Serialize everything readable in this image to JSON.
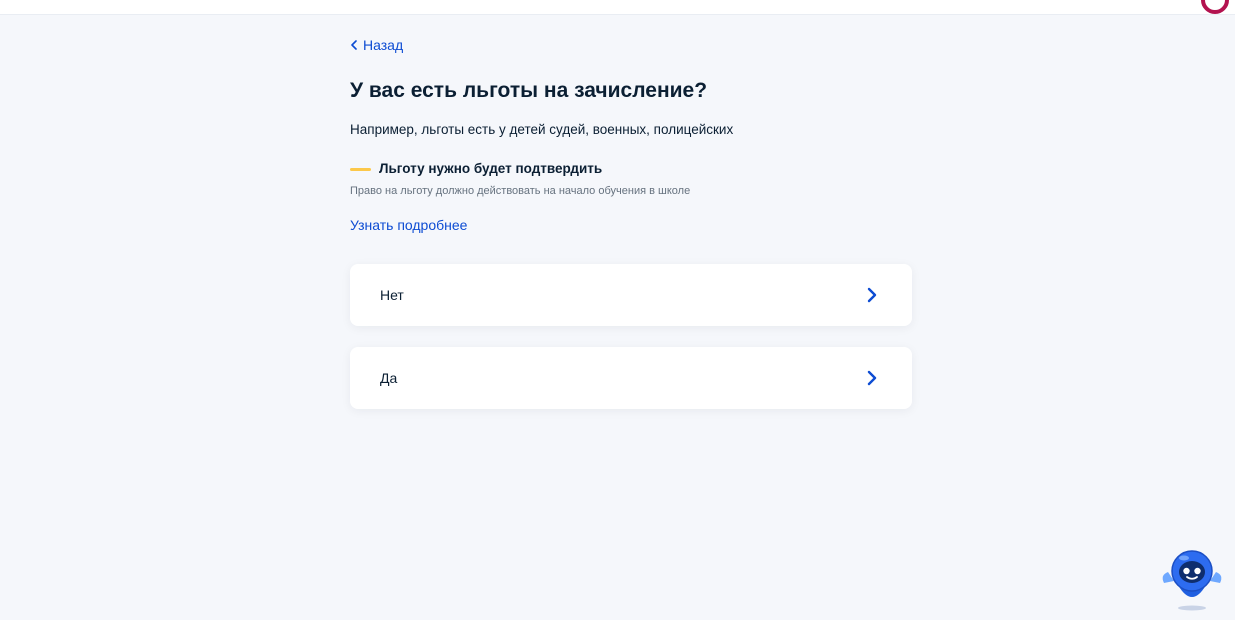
{
  "navigation": {
    "back_label": "Назад"
  },
  "question": {
    "title": "У вас есть льготы на зачисление?",
    "subtitle": "Например, льготы есть у детей судей, военных, полицейских"
  },
  "notice": {
    "heading": "Льготу нужно будет подтвердить",
    "text": "Право на льготу должно действовать на начало обучения в школе",
    "bar_color": "#fcc84a"
  },
  "more_link": {
    "label": "Узнать подробнее"
  },
  "options": [
    {
      "label": "Нет",
      "icon": "chevron-right-icon"
    },
    {
      "label": "Да",
      "icon": "chevron-right-icon"
    }
  ],
  "colors": {
    "background": "#f5f7fb",
    "link": "#0d4cd3",
    "text": "#0b1f33",
    "muted_text": "#66727f",
    "card": "#ffffff"
  },
  "assistant": {
    "icon": "assistant-robot-icon"
  }
}
